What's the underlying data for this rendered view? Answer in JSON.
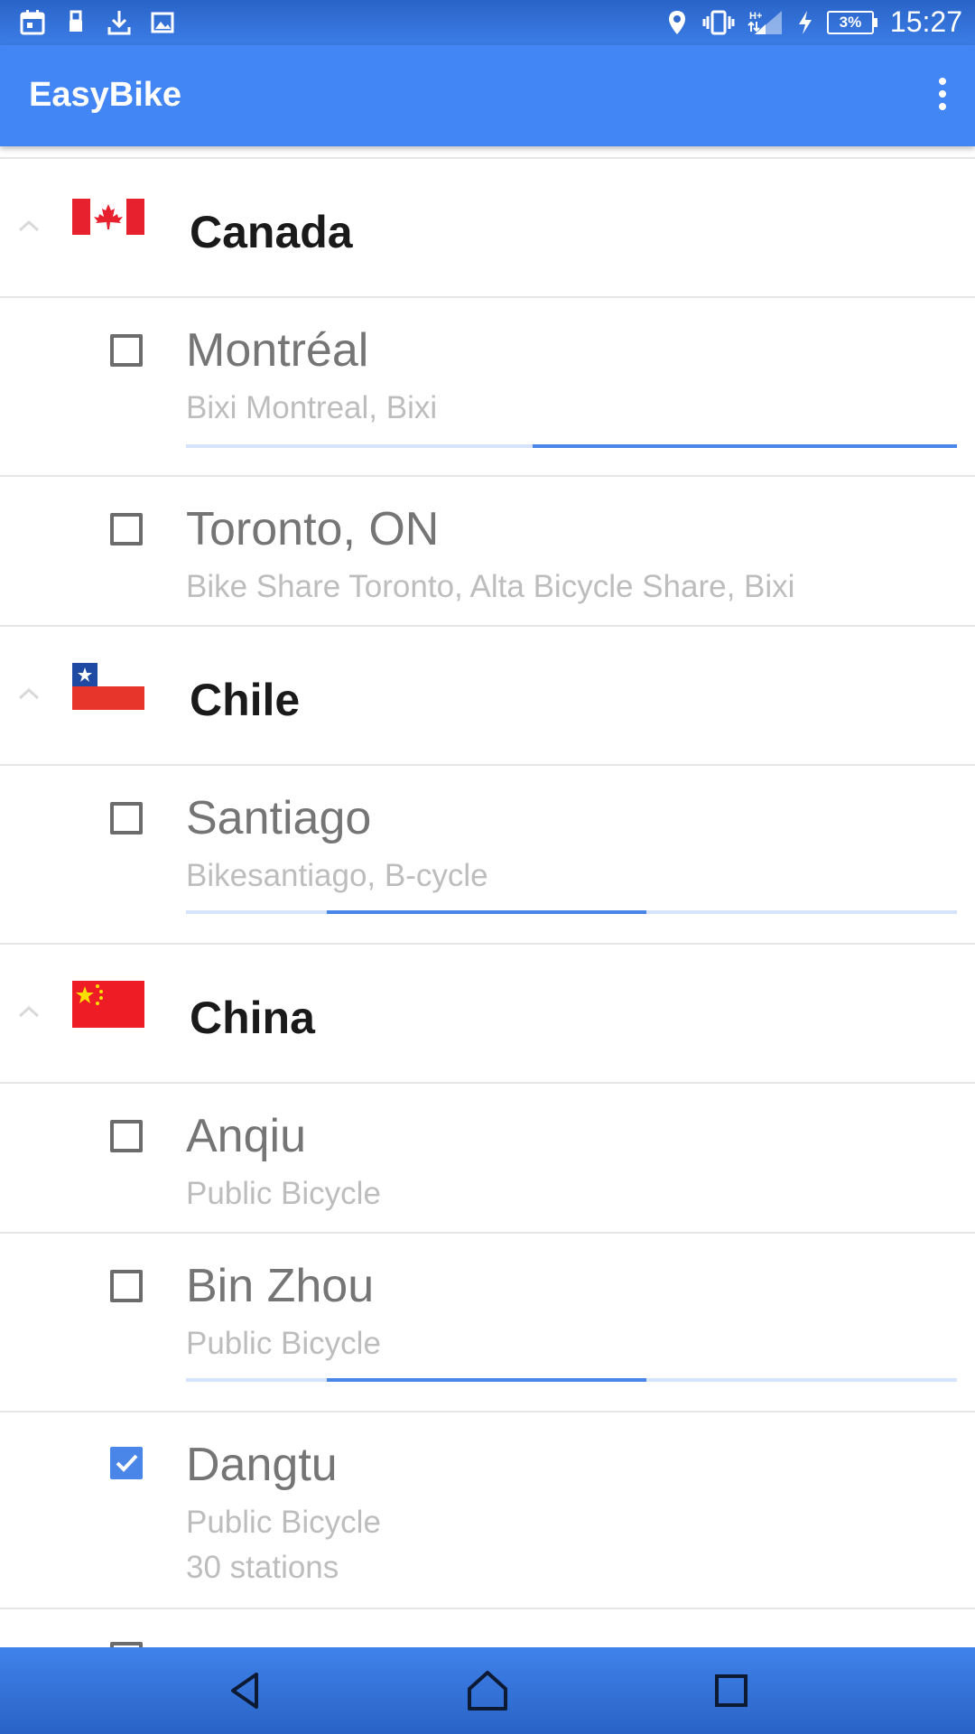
{
  "status_bar": {
    "left_icons": [
      "calendar-icon",
      "usb-icon",
      "download-icon",
      "image-icon"
    ],
    "right_icons": [
      "location-icon",
      "vibrate-icon",
      "signal-icon",
      "charging-icon"
    ],
    "network_type": "H+",
    "battery": "3%",
    "time": "15:27"
  },
  "app_bar": {
    "title": "EasyBike",
    "menu_icon": "overflow-menu-icon"
  },
  "countries": [
    {
      "name": "Canada",
      "cities": [
        {
          "name": "Montréal",
          "systems": "Bixi Montreal, Bixi",
          "checked": false
        },
        {
          "name": "Toronto, ON",
          "systems": "Bike Share Toronto, Alta Bicycle Share, Bixi",
          "checked": false
        }
      ]
    },
    {
      "name": "Chile",
      "cities": [
        {
          "name": "Santiago",
          "systems": "Bikesantiago, B-cycle",
          "checked": false
        }
      ]
    },
    {
      "name": "China",
      "cities": [
        {
          "name": "Anqiu",
          "systems": "Public Bicycle",
          "checked": false
        },
        {
          "name": "Bin Zhou",
          "systems": "Public Bicycle",
          "checked": false
        },
        {
          "name": "Dangtu",
          "systems": "Public Bicycle",
          "stations": "30 stations",
          "checked": true
        }
      ]
    }
  ],
  "colors": {
    "primary": "#4285f4",
    "status_bar": "#2a64c8",
    "accent": "#4a86e8"
  },
  "nav_bar": [
    "back-icon",
    "home-icon",
    "recents-icon"
  ]
}
